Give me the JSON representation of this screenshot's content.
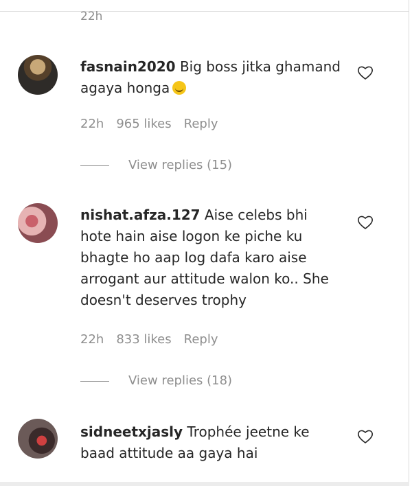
{
  "top_time": "22h",
  "comments": [
    {
      "username": "fasnain2020",
      "text": " Big boss jitka ghamand agaya honga",
      "emoji": "grinning-face",
      "time": "22h",
      "likes": "965 likes",
      "reply": "Reply",
      "view_replies": "View replies (15)"
    },
    {
      "username": "nishat.afza.127",
      "text": " Aise celebs bhi hote hain aise logon ke piche ku bhagte ho aap log dafa karo aise arrogant aur attitude walon ko.. She doesn't deserves trophy",
      "time": "22h",
      "likes": "833 likes",
      "reply": "Reply",
      "view_replies": "View replies (18)"
    },
    {
      "username": "sidneetxjasly",
      "text": " Trophée jeetne ke baad attitude aa gaya hai"
    }
  ],
  "icons": {
    "like": "heart-outline-icon"
  }
}
